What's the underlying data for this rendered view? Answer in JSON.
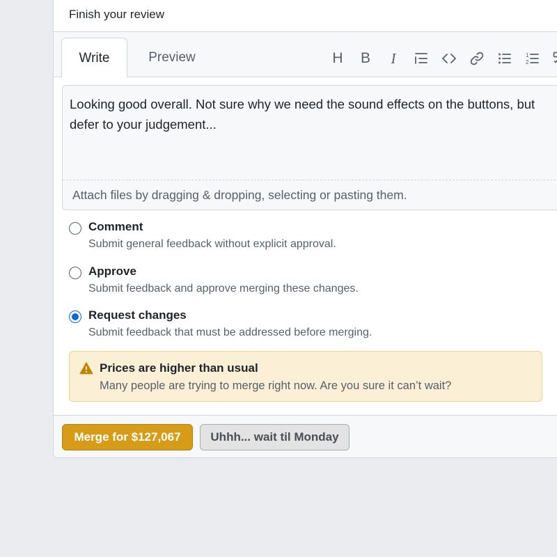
{
  "review": {
    "title": "Finish your review",
    "tabs": [
      {
        "label": "Write",
        "active": true
      },
      {
        "label": "Preview",
        "active": false
      }
    ],
    "toolbar": [
      {
        "name": "heading-icon",
        "glyph": "H"
      },
      {
        "name": "bold-icon",
        "glyph": "B"
      },
      {
        "name": "italic-icon",
        "glyph": "I"
      },
      {
        "name": "quote-icon"
      },
      {
        "name": "code-icon"
      },
      {
        "name": "link-icon"
      },
      {
        "name": "unordered-list-icon"
      },
      {
        "name": "ordered-list-icon"
      },
      {
        "name": "task-list-icon"
      }
    ],
    "comment_text": "Looking good overall. Not sure why we need the sound effects on the buttons, but defer to your judgement...",
    "attach_hint": "Attach files by dragging & dropping, selecting or pasting them.",
    "options": [
      {
        "label": "Comment",
        "description": "Submit general feedback without explicit approval.",
        "checked": false
      },
      {
        "label": "Approve",
        "description": "Submit feedback and approve merging these changes.",
        "checked": false
      },
      {
        "label": "Request changes",
        "description": "Submit feedback that must be addressed before merging.",
        "checked": true
      }
    ],
    "warning": {
      "icon": "alert-icon",
      "title": "Prices are higher than usual",
      "message": "Many people are trying to merge right now. Are you sure it can’t wait?"
    },
    "buttons": {
      "merge_label": "Merge for $127,067",
      "wait_label": "Uhhh... wait til Monday"
    }
  },
  "colors": {
    "page_bg": "#eaecef",
    "accent_blue": "#0969da",
    "merge_button": "#d69c17",
    "warning_bg": "#fbefd5",
    "warning_icon": "#bf8700"
  }
}
